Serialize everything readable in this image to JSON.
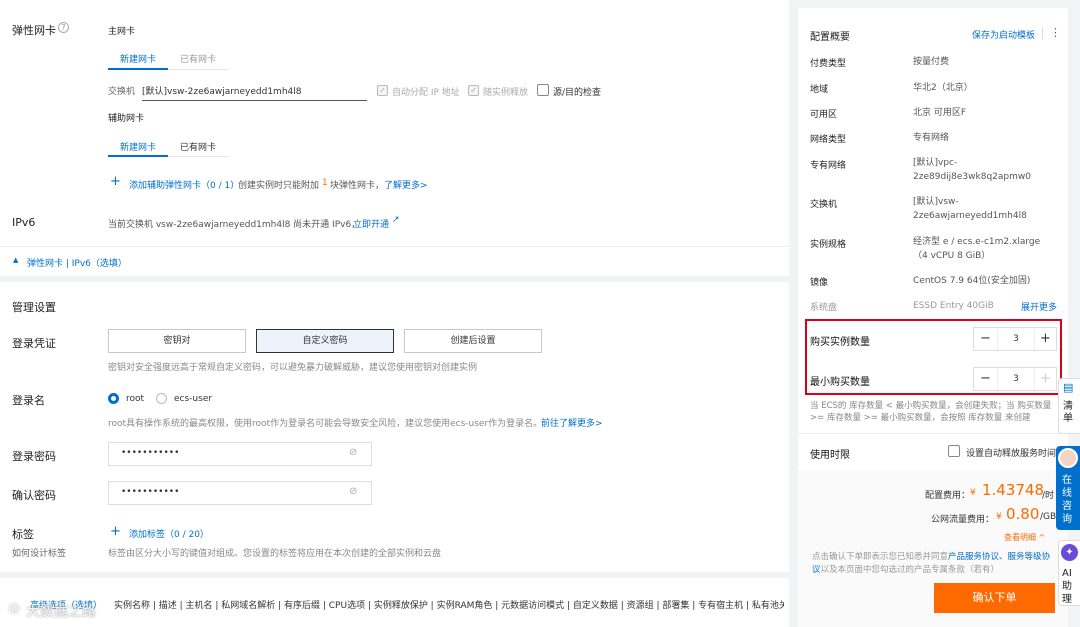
{
  "eni": {
    "section_label": "弹性网卡",
    "primary_title": "主网卡",
    "primary_tabs": [
      "新建网卡",
      "已有网卡"
    ],
    "switch_label": "交换机",
    "switch_value": "[默认]vsw-2ze6awjarneyedd1mh4l8",
    "auto_ip_label": "自动分配 IP 地址",
    "release_with_instance": "随实例释放",
    "src_dst_check": "源/目的检查",
    "secondary_title": "辅助网卡",
    "secondary_tabs": [
      "新建网卡",
      "已有网卡"
    ],
    "add_icon": "plus-icon",
    "add_secondary": "添加辅助弹性网卡（0 / 1）",
    "add_note_pre": "创建实例时只能附加",
    "add_note_num": "1",
    "add_note_post": "块弹性网卡，",
    "learn_more": "了解更多>"
  },
  "ipv6": {
    "label": "IPv6",
    "text": "当前交换机 vsw-2ze6awjarneyedd1mh4l8 尚未开通 IPv6，",
    "link": "立即开通"
  },
  "collapse_link": "弹性网卡 | IPv6（选填）",
  "mgmt": {
    "title": "管理设置",
    "cred_label": "登录凭证",
    "cred_options": [
      "密钥对",
      "自定义密码",
      "创建后设置"
    ],
    "cred_hint": "密钥对安全强度远高于常规自定义密码，可以避免暴力破解威胁，建议您使用密钥对创建实例",
    "login_name_label": "登录名",
    "login_options": [
      "root",
      "ecs-user"
    ],
    "login_hint": "root具有操作系统的最高权限，使用root作为登录名可能会导致安全风险，建议您使用ecs-user作为登录名。",
    "login_hint_link": "前往了解更多>",
    "password_label": "登录密码",
    "password_value": "•••••••••••",
    "confirm_label": "确认密码",
    "confirm_value": "•••••••••••",
    "tag_label": "标签",
    "tag_sub": "如何设计标签",
    "add_tag": "添加标签（0 / 20）",
    "tag_hint": "标签由区分大小写的键值对组成。您设置的标签将应用在本次创建的全部实例和云盘"
  },
  "bottom_bar": {
    "left_link": "高级选项（选填）",
    "items": "实例名称 | 描述 | 主机名 | 私网域名解析 | 有序后缀 | CPU选项 | 实例释放保护 | 实例RAM角色 | 元数据访问模式 | 自定义数据 | 资源组 | 部署集 | 专有宿主机 | 私有池关",
    "watermark": "大数据之路"
  },
  "summary": {
    "title": "配置概要",
    "save_template": "保存为启动模板",
    "more_icon": "more-vertical-icon",
    "rows": [
      {
        "k": "付费类型",
        "v": "按量付费"
      },
      {
        "k": "地域",
        "v": "华北2（北京）"
      },
      {
        "k": "可用区",
        "v": "北京 可用区F"
      },
      {
        "k": "网络类型",
        "v": "专有网络"
      },
      {
        "k": "专有网络",
        "v": "[默认]vpc-2ze89dij8e3wk8q2apmw0"
      },
      {
        "k": "交换机",
        "v": "[默认]vsw-2ze6awjarneyedd1mh4l8"
      },
      {
        "k": "实例规格",
        "v": "经济型 e / ecs.e-c1m2.xlarge（4 vCPU 8 GiB）"
      },
      {
        "k": "镜像",
        "v": "CentOS 7.9 64位(安全加固)"
      },
      {
        "k": "系统盘",
        "v": "ESSD Entry 40GiB"
      }
    ],
    "expand": "展开更多",
    "buy_qty_label": "购买实例数量",
    "buy_qty": "3",
    "min_qty_label": "最小购买数量",
    "min_qty": "3",
    "qty_note": "当 ECS的 库存数量 < 最小购买数量，会创建失败；当 购买数量 >= 库存数量 >= 最小购买数量，会按照 库存数量 来创建",
    "duration_label": "使用时限",
    "auto_release": "设置自动释放服务时间",
    "config_fee_label": "配置费用：",
    "config_fee_cur": "¥",
    "config_fee": "1.43748",
    "config_fee_unit": "/时",
    "traffic_fee_label": "公网流量费用：",
    "traffic_fee_cur": "¥",
    "traffic_fee": "0.80",
    "traffic_fee_unit": "/GB",
    "view_details": "查看明细 ^",
    "agree_pre": "点击确认下单即表示您已知悉并同意",
    "agree_link1": "产品服务协议、服务等级协议",
    "agree_post": "以及本页面中您勾选过的产品专属条款（若有）",
    "confirm_button": "确认下单",
    "accent": "#ff6a00",
    "highlight": "#d9001b"
  },
  "float_bar": {
    "list": "清单",
    "consult": "在线咨询",
    "ai": "AI助理"
  }
}
